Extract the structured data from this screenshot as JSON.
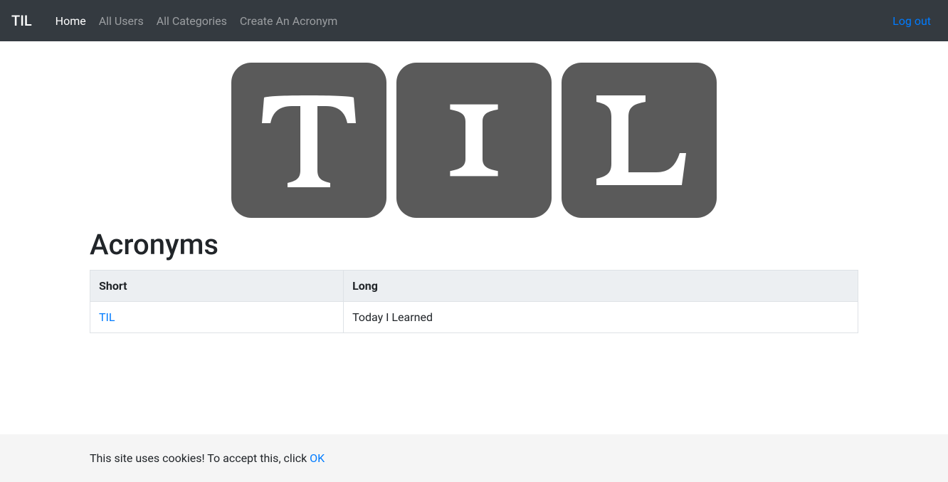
{
  "nav": {
    "brand": "TIL",
    "items": [
      {
        "label": "Home",
        "active": true
      },
      {
        "label": "All Users",
        "active": false
      },
      {
        "label": "All Categories",
        "active": false
      },
      {
        "label": "Create An Acronym",
        "active": false
      }
    ],
    "logout_label": "Log out"
  },
  "logo": {
    "letters": [
      "T",
      "I",
      "L"
    ]
  },
  "heading": "Acronyms",
  "table": {
    "headers": {
      "short": "Short",
      "long": "Long"
    },
    "rows": [
      {
        "short": "TIL",
        "long": "Today I Learned"
      }
    ]
  },
  "cookie": {
    "text": "This site uses cookies! To accept this, click ",
    "ok_label": "OK"
  }
}
